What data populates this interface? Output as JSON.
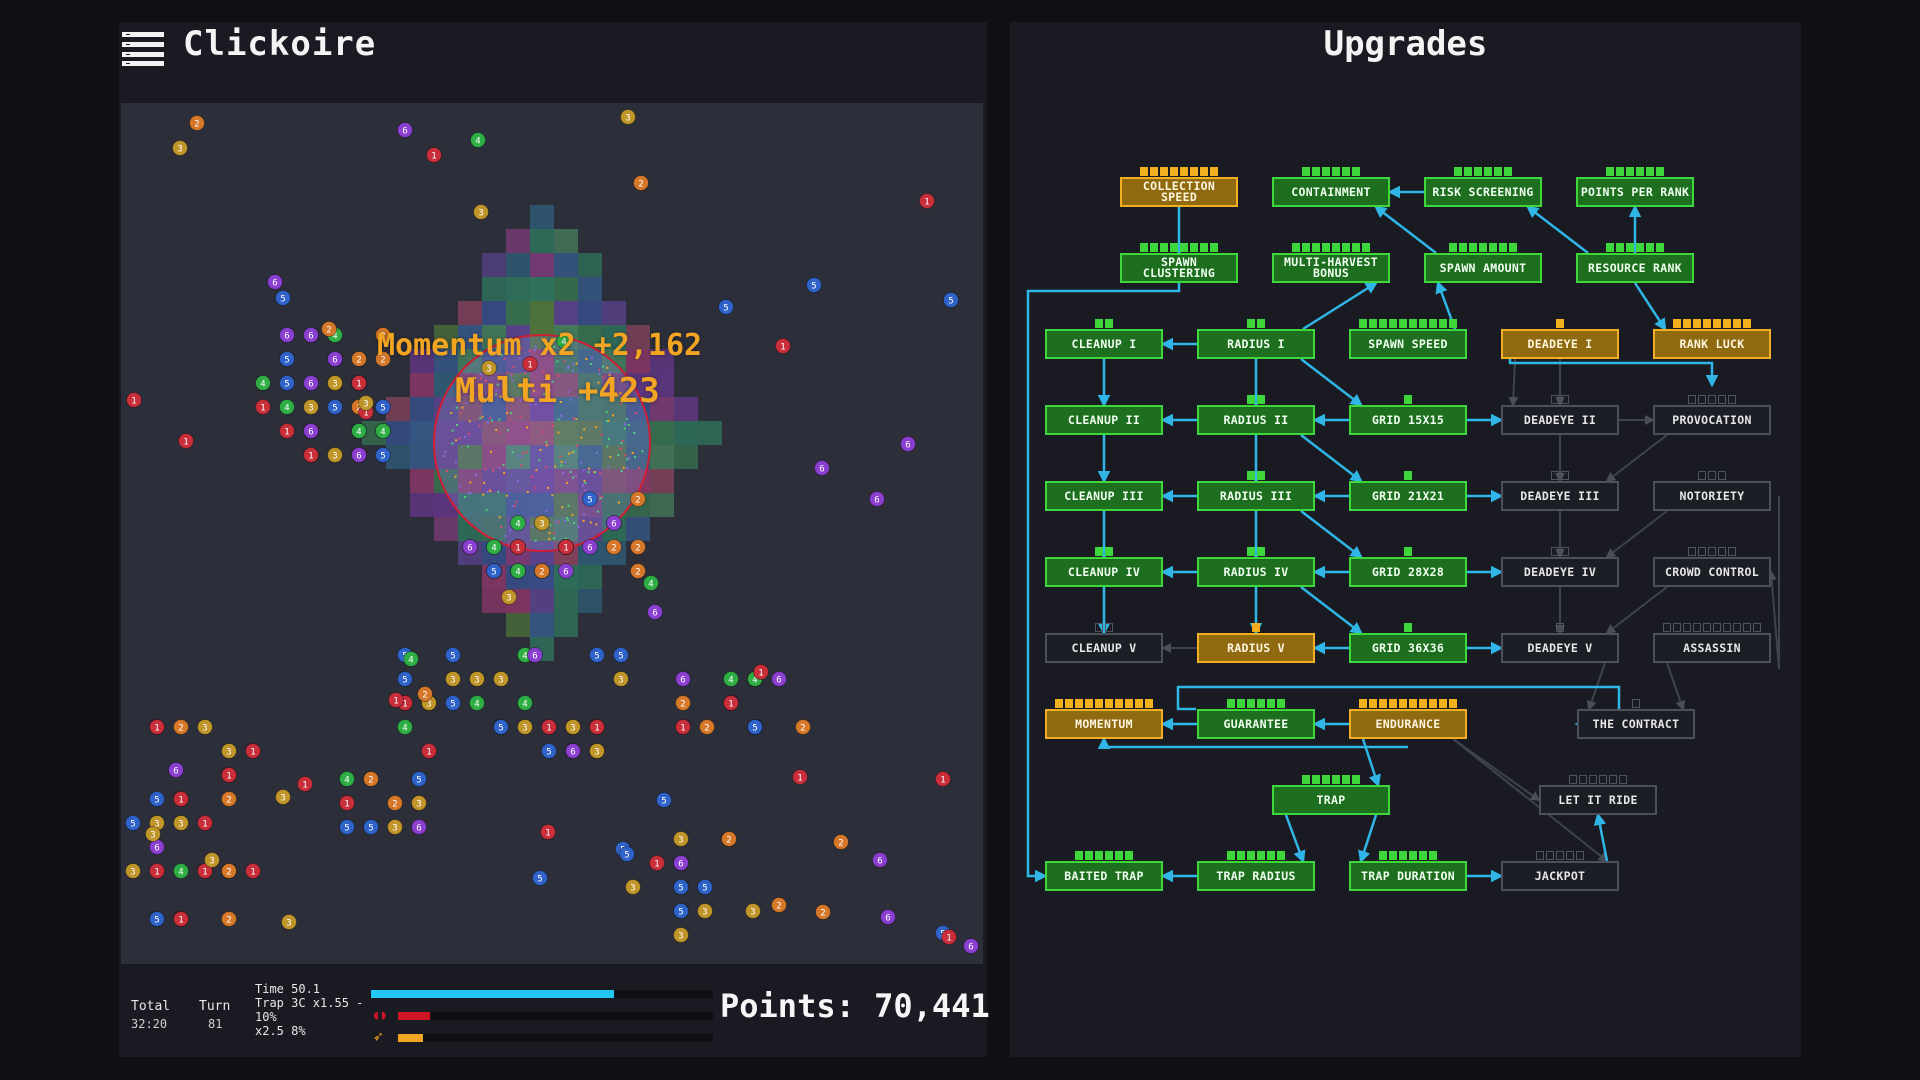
{
  "game": {
    "title": "Clickoire",
    "menu_icon": "hamburger-menu-icon"
  },
  "field": {
    "popups": {
      "momentum": "Momentum x2 +2,162",
      "multi": "Multi +423"
    }
  },
  "hud": {
    "total_label": "Total",
    "total_value": "32:20",
    "turn_label": "Turn",
    "turn_value": "81",
    "info": [
      "Time 50.1",
      "Trap 3C x1.55 -",
      "10%",
      "x2.5 8%"
    ],
    "time_progress": 0.71,
    "trap_progress": 0.1,
    "bonus_progress": 0.08,
    "trap_icon": "trap-icon",
    "bonus_icon": "arrow-icon",
    "points": "Points: 70,441",
    "colors": {
      "time": "#22c8ef",
      "trap": "#cf1626",
      "bonus": "#f2a423"
    }
  },
  "upgrades": {
    "title": "Upgrades",
    "nodes": [
      {
        "id": "collection-speed",
        "label": "COLLECTION SPEED",
        "state": "o",
        "pips": [
          8,
          8
        ]
      },
      {
        "id": "containment",
        "label": "CONTAINMENT",
        "state": "g",
        "pips": [
          6,
          6
        ]
      },
      {
        "id": "risk-screening",
        "label": "RISK SCREENING",
        "state": "g",
        "pips": [
          6,
          6
        ]
      },
      {
        "id": "points-per-rank",
        "label": "POINTS PER RANK",
        "state": "g",
        "pips": [
          6,
          6
        ]
      },
      {
        "id": "spawn-clustering",
        "label": "SPAWN CLUSTERING",
        "state": "g",
        "pips": [
          8,
          8
        ]
      },
      {
        "id": "multi-harvest-bonus",
        "label": "MULTI-HARVEST BONUS",
        "state": "g",
        "pips": [
          8,
          8
        ]
      },
      {
        "id": "spawn-amount",
        "label": "SPAWN AMOUNT",
        "state": "g",
        "pips": [
          7,
          7
        ]
      },
      {
        "id": "resource-rank",
        "label": "RESOURCE RANK",
        "state": "g",
        "pips": [
          6,
          6
        ]
      },
      {
        "id": "cleanup-1",
        "label": "CLEANUP I",
        "state": "g",
        "pips": [
          2,
          2
        ]
      },
      {
        "id": "radius-1",
        "label": "RADIUS I",
        "state": "g",
        "pips": [
          2,
          2
        ]
      },
      {
        "id": "spawn-speed",
        "label": "SPAWN SPEED",
        "state": "g",
        "pips": [
          10,
          10
        ]
      },
      {
        "id": "deadeye-1",
        "label": "DEADEYE I",
        "state": "o",
        "pips": [
          1,
          1
        ]
      },
      {
        "id": "rank-luck",
        "label": "RANK LUCK",
        "state": "o",
        "pips": [
          8,
          8
        ]
      },
      {
        "id": "cleanup-2",
        "label": "CLEANUP II",
        "state": "g",
        "pips": [
          0,
          0
        ]
      },
      {
        "id": "radius-2",
        "label": "RADIUS II",
        "state": "g",
        "pips": [
          2,
          2
        ]
      },
      {
        "id": "grid-15",
        "label": "GRID 15X15",
        "state": "g",
        "pips": [
          1,
          1
        ]
      },
      {
        "id": "deadeye-2",
        "label": "DEADEYE II",
        "state": "l",
        "pips": [
          0,
          2
        ]
      },
      {
        "id": "provocation",
        "label": "PROVOCATION",
        "state": "l",
        "pips": [
          0,
          5
        ]
      },
      {
        "id": "cleanup-3",
        "label": "CLEANUP III",
        "state": "g",
        "pips": [
          0,
          0
        ]
      },
      {
        "id": "radius-3",
        "label": "RADIUS III",
        "state": "g",
        "pips": [
          2,
          2
        ]
      },
      {
        "id": "grid-21",
        "label": "GRID 21X21",
        "state": "g",
        "pips": [
          1,
          1
        ]
      },
      {
        "id": "deadeye-3",
        "label": "DEADEYE III",
        "state": "l",
        "pips": [
          0,
          2
        ]
      },
      {
        "id": "notoriety",
        "label": "NOTORIETY",
        "state": "l",
        "pips": [
          0,
          3
        ]
      },
      {
        "id": "cleanup-4",
        "label": "CLEANUP IV",
        "state": "g",
        "pips": [
          2,
          2
        ]
      },
      {
        "id": "radius-4",
        "label": "RADIUS IV",
        "state": "g",
        "pips": [
          2,
          2
        ]
      },
      {
        "id": "grid-28",
        "label": "GRID 28X28",
        "state": "g",
        "pips": [
          1,
          1
        ]
      },
      {
        "id": "deadeye-4",
        "label": "DEADEYE IV",
        "state": "l",
        "pips": [
          0,
          2
        ]
      },
      {
        "id": "crowd-control",
        "label": "CROWD CONTROL",
        "state": "l",
        "pips": [
          0,
          5
        ]
      },
      {
        "id": "cleanup-5",
        "label": "CLEANUP V",
        "state": "l",
        "pips": [
          0,
          2
        ]
      },
      {
        "id": "radius-5",
        "label": "RADIUS V",
        "state": "o",
        "pips": [
          1,
          1
        ]
      },
      {
        "id": "grid-36",
        "label": "GRID 36X36",
        "state": "g",
        "pips": [
          1,
          1
        ]
      },
      {
        "id": "deadeye-5",
        "label": "DEADEYE V",
        "state": "l",
        "pips": [
          0,
          1
        ]
      },
      {
        "id": "assassin",
        "label": "ASSASSIN",
        "state": "l",
        "pips": [
          0,
          10
        ]
      },
      {
        "id": "momentum",
        "label": "MOMENTUM",
        "state": "o",
        "pips": [
          10,
          10
        ]
      },
      {
        "id": "guarantee",
        "label": "GUARANTEE",
        "state": "g",
        "pips": [
          6,
          6
        ]
      },
      {
        "id": "endurance",
        "label": "ENDURANCE",
        "state": "o",
        "pips": [
          10,
          10
        ]
      },
      {
        "id": "the-contract",
        "label": "THE CONTRACT",
        "state": "l",
        "pips": [
          0,
          1
        ]
      },
      {
        "id": "trap",
        "label": "TRAP",
        "state": "g",
        "pips": [
          6,
          6
        ]
      },
      {
        "id": "let-it-ride",
        "label": "LET IT RIDE",
        "state": "l",
        "pips": [
          0,
          6
        ]
      },
      {
        "id": "baited-trap",
        "label": "BAITED TRAP",
        "state": "g",
        "pips": [
          6,
          6
        ]
      },
      {
        "id": "trap-radius",
        "label": "TRAP RADIUS",
        "state": "g",
        "pips": [
          6,
          6
        ]
      },
      {
        "id": "trap-duration",
        "label": "TRAP DURATION",
        "state": "g",
        "pips": [
          6,
          6
        ]
      },
      {
        "id": "jackpot",
        "label": "JACKPOT",
        "state": "l",
        "pips": [
          0,
          5
        ]
      }
    ]
  }
}
